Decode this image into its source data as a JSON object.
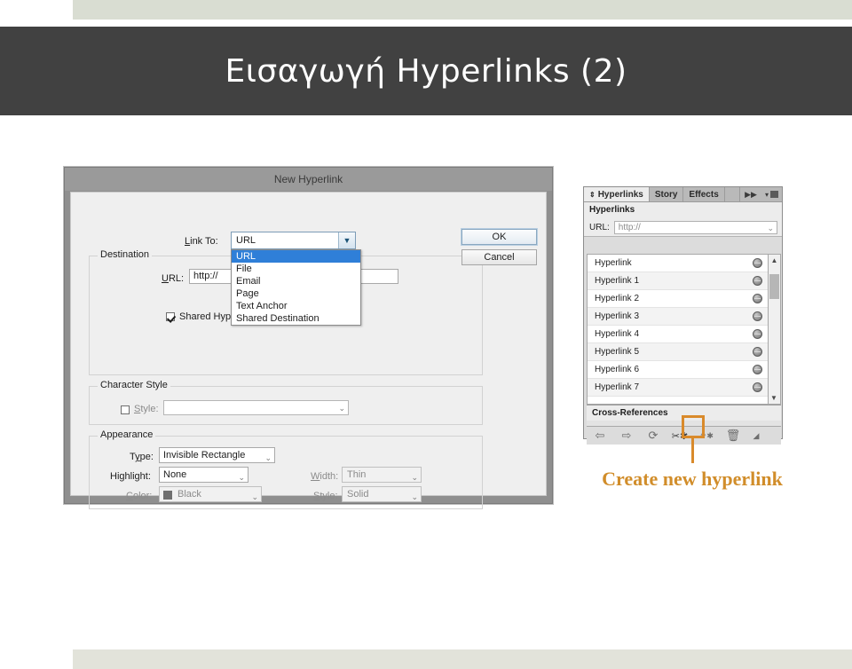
{
  "slide": {
    "title": "Εισαγωγή Hyperlinks (2)",
    "accent_color": "#d18d2a",
    "band_color": "#414141",
    "bar_color": "#d9ddd2"
  },
  "dialog": {
    "title": "New Hyperlink",
    "link_to": {
      "label": "Link To:",
      "value": "URL",
      "options": [
        "URL",
        "File",
        "Email",
        "Page",
        "Text Anchor",
        "Shared Destination"
      ],
      "selected_option": "URL",
      "expanded": true
    },
    "destination": {
      "legend": "Destination",
      "url_label": "URL:",
      "url_value": "http://",
      "shared_label": "Shared Hyperlink Destination",
      "shared_checked": true
    },
    "character_style": {
      "legend": "Character Style",
      "style_label": "Style:",
      "style_value": "",
      "style_checked": false
    },
    "appearance": {
      "legend": "Appearance",
      "type_label": "Type:",
      "type_value": "Invisible Rectangle",
      "highlight_label": "Highlight:",
      "highlight_value": "None",
      "color_label": "Color:",
      "color_value": "Black",
      "color_swatch": "#6f6f6f",
      "width_label": "Width:",
      "width_value": "Thin",
      "style_label": "Style:",
      "style_value": "Solid"
    },
    "buttons": {
      "ok": "OK",
      "cancel": "Cancel"
    }
  },
  "panel": {
    "tabs": [
      {
        "label": "Hyperlinks",
        "active": true
      },
      {
        "label": "Story",
        "active": false
      },
      {
        "label": "Effects",
        "active": false
      }
    ],
    "overflow_icon": "double-chevron-right-icon",
    "menu_icon": "panel-menu-icon",
    "heading": "Hyperlinks",
    "url_label": "URL:",
    "url_placeholder": "http://",
    "url_value": "http://",
    "items": [
      "Hyperlink",
      "Hyperlink 1",
      "Hyperlink 2",
      "Hyperlink 3",
      "Hyperlink 4",
      "Hyperlink 5",
      "Hyperlink 6",
      "Hyperlink 7"
    ],
    "crossrefs_label": "Cross-References",
    "toolbar": [
      {
        "name": "go-back-icon",
        "glyph": "⇦"
      },
      {
        "name": "go-forward-icon",
        "glyph": "⇨"
      },
      {
        "name": "refresh-icon",
        "glyph": "⟳"
      },
      {
        "name": "create-new-hyperlink-icon",
        "glyph": "✂✳"
      },
      {
        "name": "new-cross-reference-icon",
        "glyph": "⚯✳"
      },
      {
        "name": "delete-hyperlink-icon",
        "glyph": "🗑"
      },
      {
        "name": "resize-grip-icon",
        "glyph": "◢"
      }
    ],
    "scroll_up_icon": "chevron-up-icon",
    "scroll_down_icon": "chevron-down-icon"
  },
  "annotation": {
    "caption": "Create new hyperlink",
    "highlight_target": "create-new-hyperlink-icon"
  }
}
